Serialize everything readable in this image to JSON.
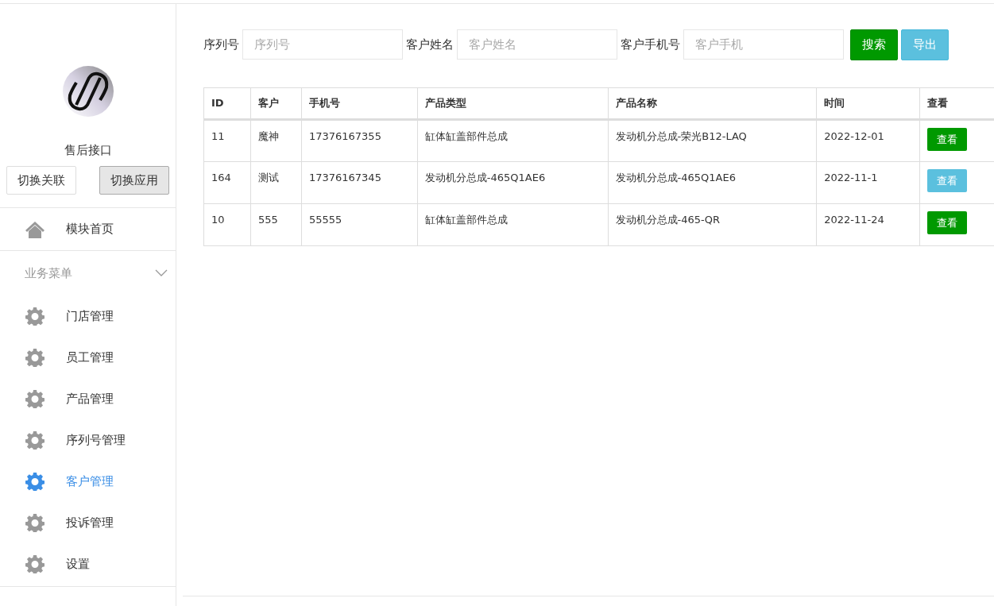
{
  "sidebar": {
    "app_name": "售后接口",
    "switch_buttons": [
      {
        "label": "切换关联",
        "selected": false
      },
      {
        "label": "切换应用",
        "selected": true
      }
    ],
    "home_item": {
      "label": "模块首页",
      "selected": false
    },
    "menu_group": {
      "title": "业务菜单",
      "expanded": true,
      "items": [
        {
          "label": "门店管理",
          "selected": false
        },
        {
          "label": "员工管理",
          "selected": false
        },
        {
          "label": "产品管理",
          "selected": false
        },
        {
          "label": "序列号管理",
          "selected": false
        },
        {
          "label": "客户管理",
          "selected": true
        },
        {
          "label": "投诉管理",
          "selected": false
        },
        {
          "label": "设置",
          "selected": false
        }
      ]
    }
  },
  "search": {
    "fields": [
      {
        "label": "序列号",
        "placeholder": "序列号"
      },
      {
        "label": "客户姓名",
        "placeholder": "客户姓名"
      },
      {
        "label": "客户手机号",
        "placeholder": "客户手机"
      }
    ],
    "buttons": [
      {
        "label": "搜索",
        "kind": "success"
      },
      {
        "label": "导出",
        "kind": "info"
      }
    ]
  },
  "table": {
    "columns": [
      "ID",
      "客户",
      "手机号",
      "产品类型",
      "产品名称",
      "时间",
      "查看"
    ],
    "rows": [
      {
        "cells": [
          "11",
          "魔神",
          "17376167355",
          "缸体缸盖部件总成",
          "发动机分总成-荣光B12-LAQ",
          "2022-12-01"
        ],
        "view_button": {
          "label": "查看",
          "kind": "success"
        }
      },
      {
        "cells": [
          "164",
          "测试",
          "17376167345",
          "发动机分总成-465Q1AE6",
          "发动机分总成-465Q1AE6",
          "2022-11-1"
        ],
        "view_button": {
          "label": "查看",
          "kind": "info"
        }
      },
      {
        "cells": [
          "10",
          "555",
          "55555",
          "缸体缸盖部件总成",
          "发动机分总成-465-QR",
          "2022-11-24"
        ],
        "view_button": {
          "label": "查看",
          "kind": "success"
        }
      }
    ]
  }
}
